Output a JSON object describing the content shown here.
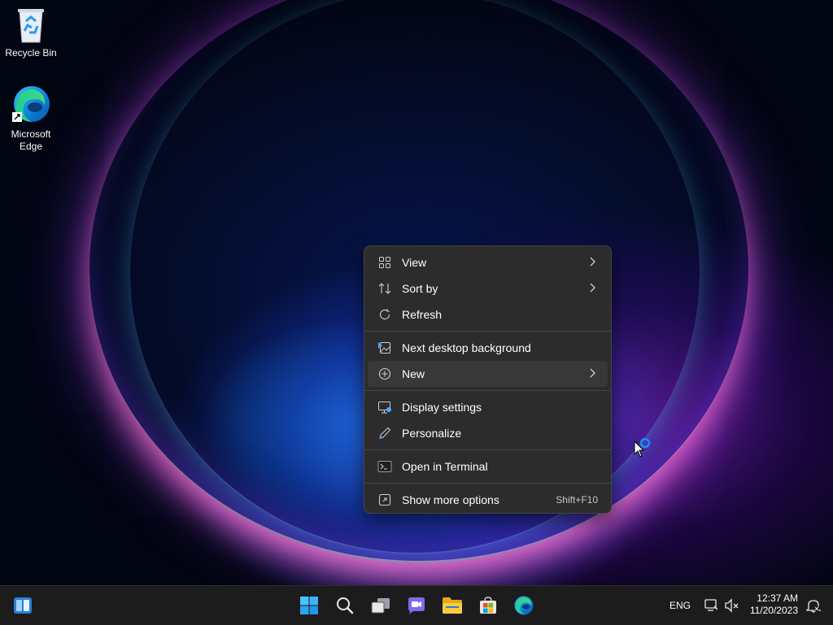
{
  "desktop": {
    "icons": [
      {
        "label": "Recycle Bin",
        "icon": "recycle-bin-icon"
      },
      {
        "label": "Microsoft\nEdge",
        "label_line1": "Microsoft",
        "label_line2": "Edge",
        "icon": "edge-icon"
      }
    ]
  },
  "context_menu": {
    "items": [
      {
        "label": "View",
        "icon": "grid-icon",
        "submenu": true
      },
      {
        "label": "Sort by",
        "icon": "sort-icon",
        "submenu": true
      },
      {
        "label": "Refresh",
        "icon": "refresh-icon"
      },
      {
        "label": "Next desktop background",
        "icon": "image-next-icon"
      },
      {
        "label": "New",
        "icon": "plus-circle-icon",
        "submenu": true,
        "highlighted": true
      },
      {
        "label": "Display settings",
        "icon": "display-icon"
      },
      {
        "label": "Personalize",
        "icon": "pen-icon"
      },
      {
        "label": "Open in Terminal",
        "icon": "terminal-icon"
      },
      {
        "label": "Show more options",
        "icon": "more-options-icon",
        "shortcut": "Shift+F10"
      }
    ]
  },
  "taskbar": {
    "apps": [
      "widgets-icon",
      "start-icon",
      "search-icon",
      "task-view-icon",
      "chat-icon",
      "file-explorer-icon",
      "store-icon",
      "edge-icon"
    ],
    "language": "ENG",
    "time": "12:37 AM",
    "date": "11/20/2023"
  },
  "colors": {
    "menu_bg": "#2c2c2c",
    "menu_hover": "#383838",
    "taskbar_bg": "#1c1c1c",
    "accent": "#1a8cff"
  }
}
